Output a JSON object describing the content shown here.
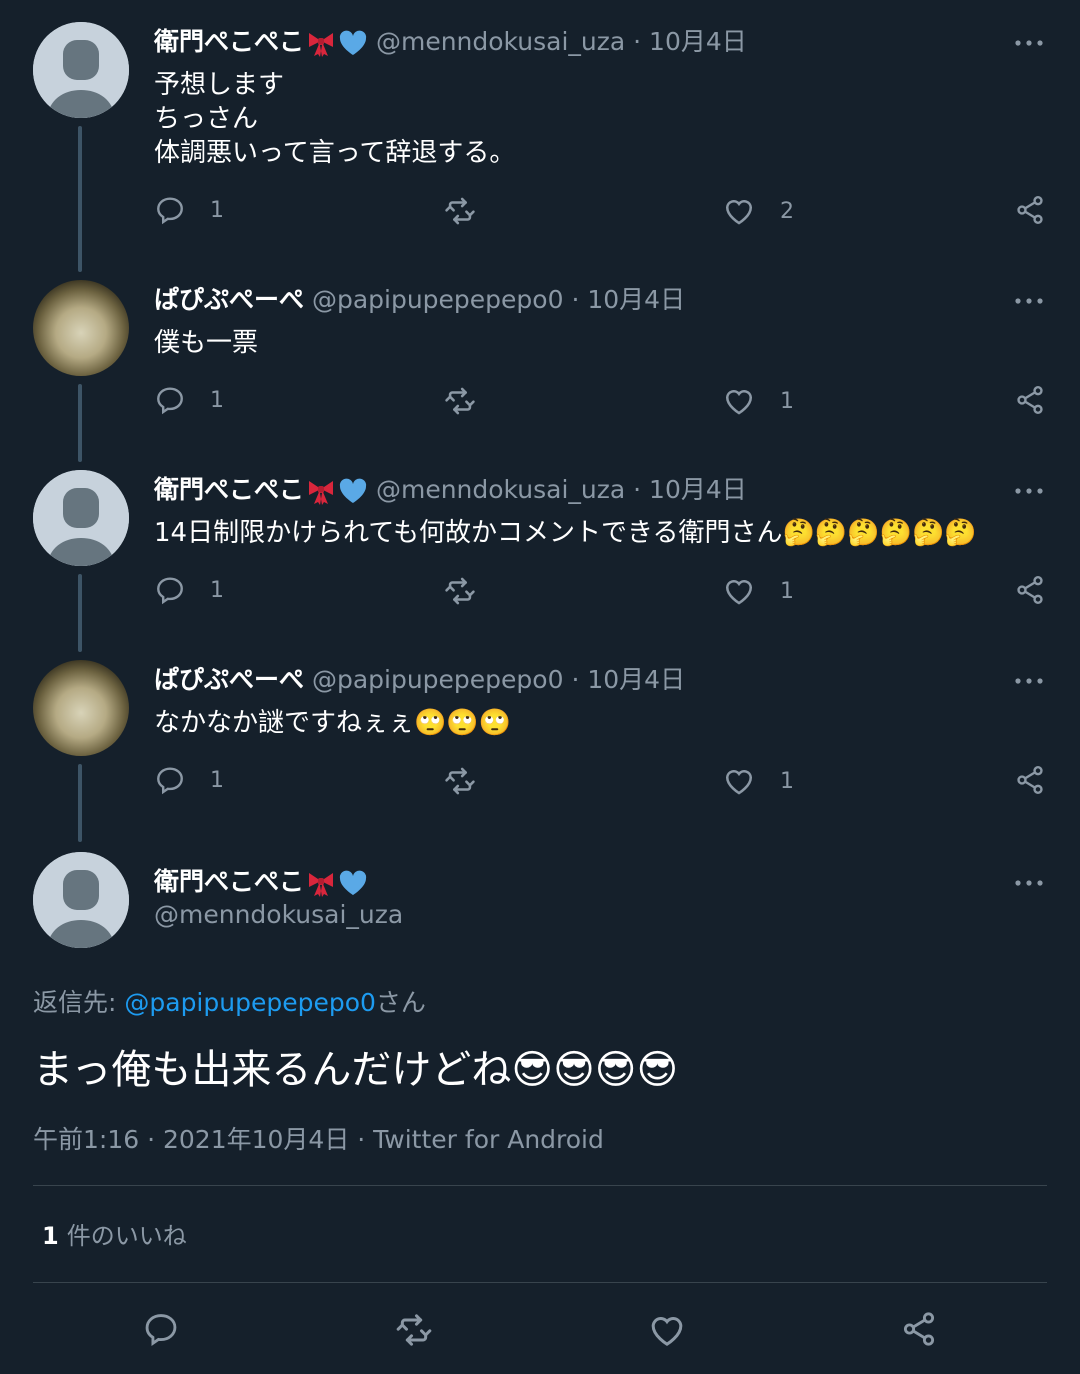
{
  "tweets": [
    {
      "name": "衛門ぺこぺこ",
      "handle": "@menndokusai_uza",
      "sep": "·",
      "date": "10月4日",
      "text": "予想します\nちっさん\n体調悪いって言って辞退する。",
      "reply_count": "1",
      "like_count": "2"
    },
    {
      "name": "ぱぴぷぺーぺ",
      "handle": "@papipupepepepo0",
      "sep": "·",
      "date": "10月4日",
      "text": "僕も一票",
      "reply_count": "1",
      "like_count": "1"
    },
    {
      "name": "衛門ぺこぺこ",
      "handle": "@menndokusai_uza",
      "sep": "·",
      "date": "10月4日",
      "text": "14日制限かけられても何故かコメントできる衛門さん🤔🤔🤔🤔🤔🤔",
      "reply_count": "1",
      "like_count": "1"
    },
    {
      "name": "ぱぴぷぺーぺ",
      "handle": "@papipupepepepo0",
      "sep": "·",
      "date": "10月4日",
      "text": "なかなか謎ですねぇぇ🙄🙄🙄",
      "reply_count": "1",
      "like_count": "1"
    }
  ],
  "main_tweet": {
    "name": "衛門ぺこぺこ",
    "handle": "@menndokusai_uza",
    "reply_prefix": "返信先: ",
    "reply_mention": "@papipupepepepo0",
    "reply_suffix": "さん",
    "text": "まっ俺も出来るんだけどね😎😎😎😎",
    "meta": "午前1:16 · 2021年10月4日 · Twitter for Android",
    "likes_count": "1",
    "likes_label": "件のいいね"
  },
  "icons": {
    "reply": "reply-icon",
    "retweet": "retweet-icon",
    "like": "heart-icon",
    "share": "share-icon",
    "more": "more-icon",
    "badge_1": "ribbon-emoji",
    "badge_2": "blue-heart-emoji"
  },
  "colors": {
    "background": "#15202b",
    "secondary_text": "#8b98a5",
    "accent": "#1d9bf0",
    "divider": "#38444d"
  }
}
